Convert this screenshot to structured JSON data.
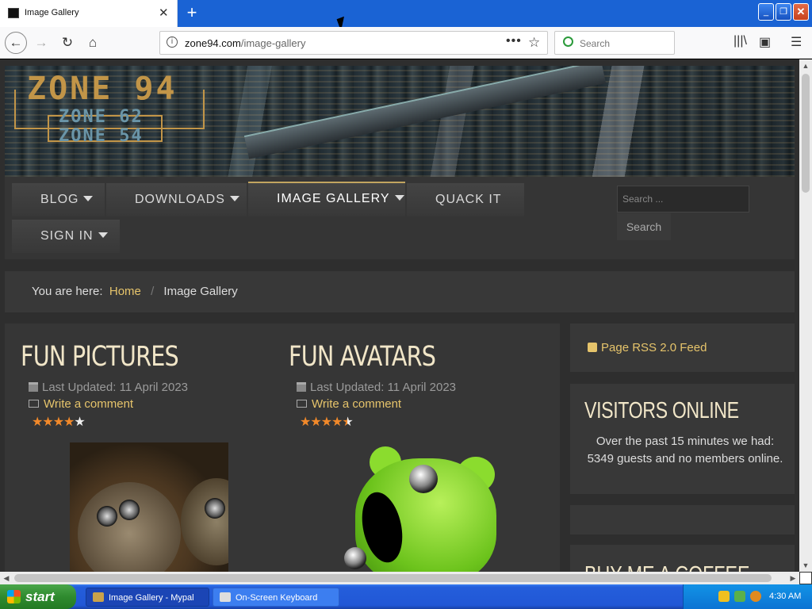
{
  "browser": {
    "tab_title": "Image Gallery",
    "tab_close": "✕",
    "new_tab": "+",
    "url_domain": "zone94.com",
    "url_path": "/image-gallery",
    "search_placeholder": "Search",
    "window_controls": {
      "minimize": "_",
      "restore": "❐",
      "close": "✕"
    },
    "icons": [
      "back-icon",
      "forward-icon",
      "reload-icon",
      "home-icon",
      "info-icon",
      "page-actions-icon",
      "bookmark-star-icon",
      "search-icon",
      "library-icon",
      "sidebar-icon",
      "menu-icon"
    ]
  },
  "site": {
    "logo_main": "ZONE 94",
    "logo_sub1": "ZONE 62",
    "logo_sub2": "ZONE 54",
    "menu": [
      {
        "label": "BLOG",
        "has_caret": true
      },
      {
        "label": "DOWNLOADS",
        "has_caret": true
      },
      {
        "label": "IMAGE GALLERY",
        "has_caret": true,
        "active": true
      },
      {
        "label": "QUACK IT",
        "has_caret": false
      },
      {
        "label": "SIGN IN",
        "has_caret": true
      }
    ],
    "search_placeholder": "Search ...",
    "search_button": "Search",
    "breadcrumb": {
      "prefix": "You are here:",
      "home": "Home",
      "separator": "/",
      "current": "Image Gallery"
    },
    "articles": [
      {
        "title": "FUN PICTURES",
        "updated": "Last Updated: 11 April 2023",
        "comment": "Write a comment",
        "rating": 4,
        "rating_max": 5
      },
      {
        "title": "FUN AVATARS",
        "updated": "Last Updated: 11 April 2023",
        "comment": "Write a comment",
        "rating": 4.5,
        "rating_max": 5
      }
    ],
    "sidebar": {
      "rss": "Page RSS 2.0 Feed",
      "visitors_title": "VISITORS ONLINE",
      "visitors_text": "Over the past 15 minutes we had: 5349 guests and no members online.",
      "coffee_title": "BUY ME A COFFEE"
    },
    "colors": {
      "accent": "#e6c46b",
      "title": "#f1e6c8",
      "panel": "#383838",
      "star": "#f2892a"
    }
  },
  "taskbar": {
    "start": "start",
    "tasks": [
      {
        "label": "Image Gallery - Mypal",
        "active": true
      },
      {
        "label": "On-Screen Keyboard",
        "active": false
      }
    ],
    "time": "4:30 AM"
  }
}
